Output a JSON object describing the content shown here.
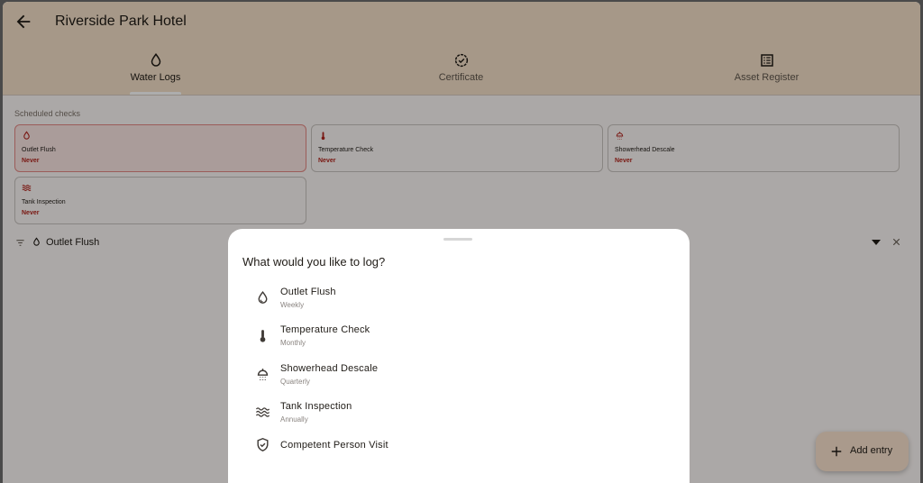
{
  "app": {
    "title": "Riverside Park Hotel"
  },
  "tabs": [
    {
      "label": "Water Logs",
      "icon": "water-drop-icon",
      "active": true
    },
    {
      "label": "Certificate",
      "icon": "verified-badge-icon",
      "active": false
    },
    {
      "label": "Asset Register",
      "icon": "list-alt-icon",
      "active": false
    }
  ],
  "scheduled": {
    "label": "Scheduled checks",
    "cards": [
      {
        "name": "Outlet Flush",
        "status": "Never",
        "icon": "water-drop-icon"
      },
      {
        "name": "Temperature Check",
        "status": "Never",
        "icon": "thermometer-icon"
      },
      {
        "name": "Showerhead Descale",
        "status": "Never",
        "icon": "shower-icon"
      },
      {
        "name": "Tank Inspection",
        "status": "Never",
        "icon": "waves-icon"
      }
    ]
  },
  "filter": {
    "selected": "Outlet Flush"
  },
  "fab": {
    "label": "Add entry"
  },
  "sheet": {
    "title": "What would you like to log?",
    "options": [
      {
        "name": "Outlet Flush",
        "frequency": "Weekly",
        "icon": "water-drop-icon"
      },
      {
        "name": "Temperature Check",
        "frequency": "Monthly",
        "icon": "thermometer-icon"
      },
      {
        "name": "Showerhead Descale",
        "frequency": "Quarterly",
        "icon": "shower-icon"
      },
      {
        "name": "Tank Inspection",
        "frequency": "Annually",
        "icon": "waves-icon"
      },
      {
        "name": "Competent Person Visit",
        "frequency": "",
        "icon": "shield-check-icon"
      }
    ]
  },
  "colors": {
    "appbar": "#f5e1c9",
    "background": "#fdf8f6",
    "alert": "#b3261e",
    "fab": "#fbe4cf"
  }
}
